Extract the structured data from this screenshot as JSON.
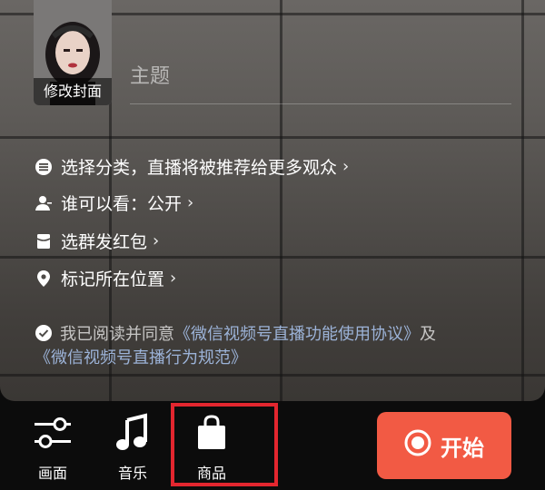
{
  "cover": {
    "label": "修改封面"
  },
  "topic": {
    "placeholder": "主题"
  },
  "options": [
    {
      "icon": "list-icon",
      "label": "选择分类，直播将被推荐给更多观众"
    },
    {
      "icon": "person-icon",
      "label": "谁可以看：公开"
    },
    {
      "icon": "red-packet-icon",
      "label": "选群发红包"
    },
    {
      "icon": "location-pin-icon",
      "label": "标记所在位置"
    }
  ],
  "agreement": {
    "prefix": "我已阅读并同意",
    "link1": "《微信视频号直播功能使用协议》",
    "middle": "及",
    "link2": "《微信视频号直播行为规范》"
  },
  "toolbar": {
    "items": [
      {
        "icon": "sliders-icon",
        "label": "画面"
      },
      {
        "icon": "music-note-icon",
        "label": "音乐"
      },
      {
        "icon": "shopping-bag-icon",
        "label": "商品"
      }
    ],
    "start_label": "开始"
  },
  "colors": {
    "start_button": "#f25a44",
    "highlight_box": "#e3262f",
    "link": "#9cb3d8"
  }
}
